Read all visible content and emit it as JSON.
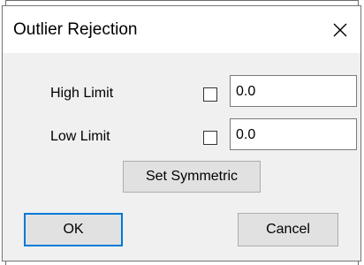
{
  "dialog": {
    "title": "Outlier Rejection",
    "close_icon": "close-icon"
  },
  "fields": {
    "high_limit": {
      "label": "High Limit",
      "checked": false,
      "value": "0.0"
    },
    "low_limit": {
      "label": "Low Limit",
      "checked": false,
      "value": "0.0"
    }
  },
  "buttons": {
    "set_symmetric": "Set Symmetric",
    "ok": "OK",
    "cancel": "Cancel"
  },
  "colors": {
    "dialog_bg": "#f0f0f0",
    "titlebar_bg": "#ffffff",
    "button_bg": "#e1e1e1",
    "focus_border": "#0078d7"
  }
}
